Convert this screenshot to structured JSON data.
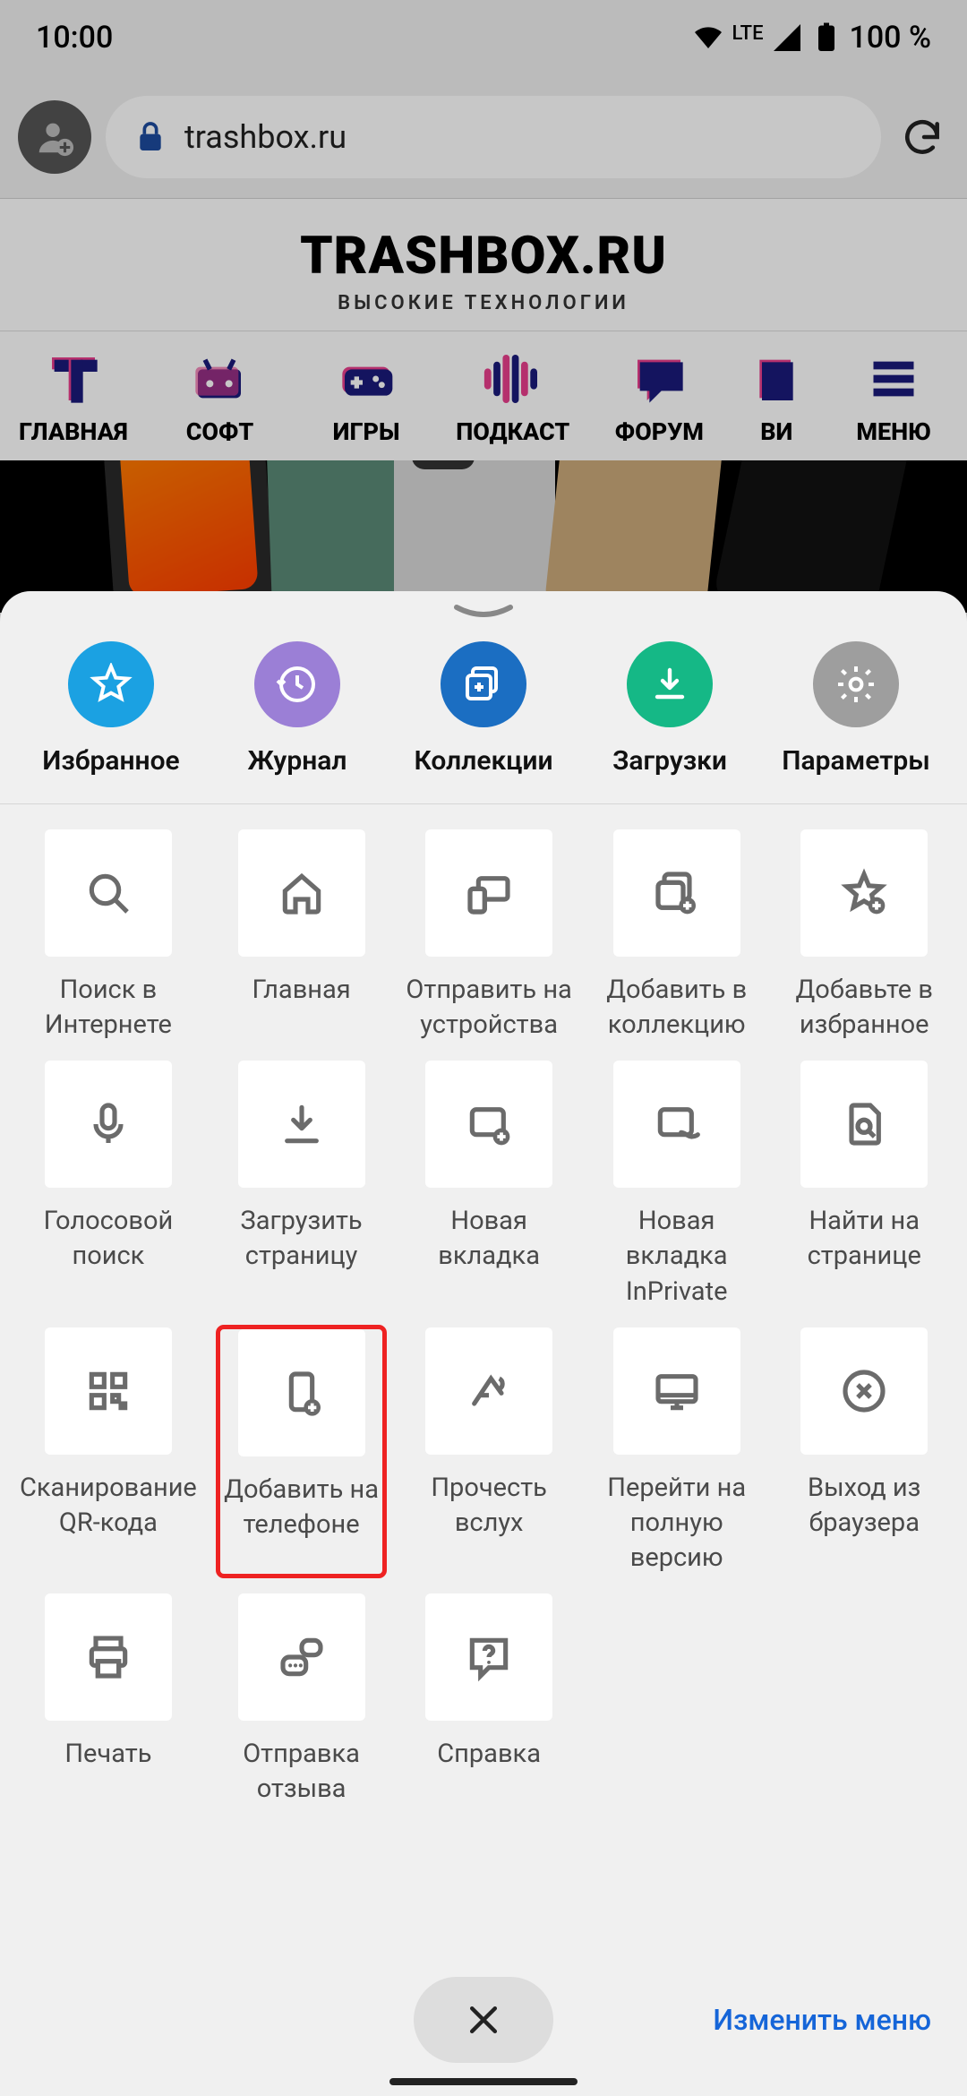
{
  "status": {
    "time": "10:00",
    "lte": "LTE",
    "battery": "100 %"
  },
  "browser": {
    "url": "trashbox.ru"
  },
  "site": {
    "title": "TRASHBOX.RU",
    "subtitle": "ВЫСОКИЕ ТЕХНОЛОГИИ",
    "nav": [
      "ГЛАВНАЯ",
      "СОФТ",
      "ИГРЫ",
      "ПОДКАСТ",
      "ФОРУМ",
      "ВИ",
      "МЕНЮ"
    ]
  },
  "sheet": {
    "top": [
      {
        "label": "Избранное"
      },
      {
        "label": "Журнал"
      },
      {
        "label": "Коллекции"
      },
      {
        "label": "Загрузки"
      },
      {
        "label": "Параметры"
      }
    ],
    "tiles": [
      {
        "label": "Поиск в Интернете"
      },
      {
        "label": "Главная"
      },
      {
        "label": "Отправить на устройства"
      },
      {
        "label": "Добавить в коллекцию"
      },
      {
        "label": "Добавьте в избранное"
      },
      {
        "label": "Голосовой поиск"
      },
      {
        "label": "Загрузить страницу"
      },
      {
        "label": "Новая вкладка"
      },
      {
        "label": "Новая вкладка InPrivate"
      },
      {
        "label": "Найти на странице"
      },
      {
        "label": "Сканирование QR-кода"
      },
      {
        "label": "Добавить на телефоне"
      },
      {
        "label": "Прочесть вслух"
      },
      {
        "label": "Перейти на полную версию"
      },
      {
        "label": "Выход из браузера"
      },
      {
        "label": "Печать"
      },
      {
        "label": "Отправка отзыва"
      },
      {
        "label": "Справка"
      }
    ],
    "edit": "Изменить меню"
  }
}
